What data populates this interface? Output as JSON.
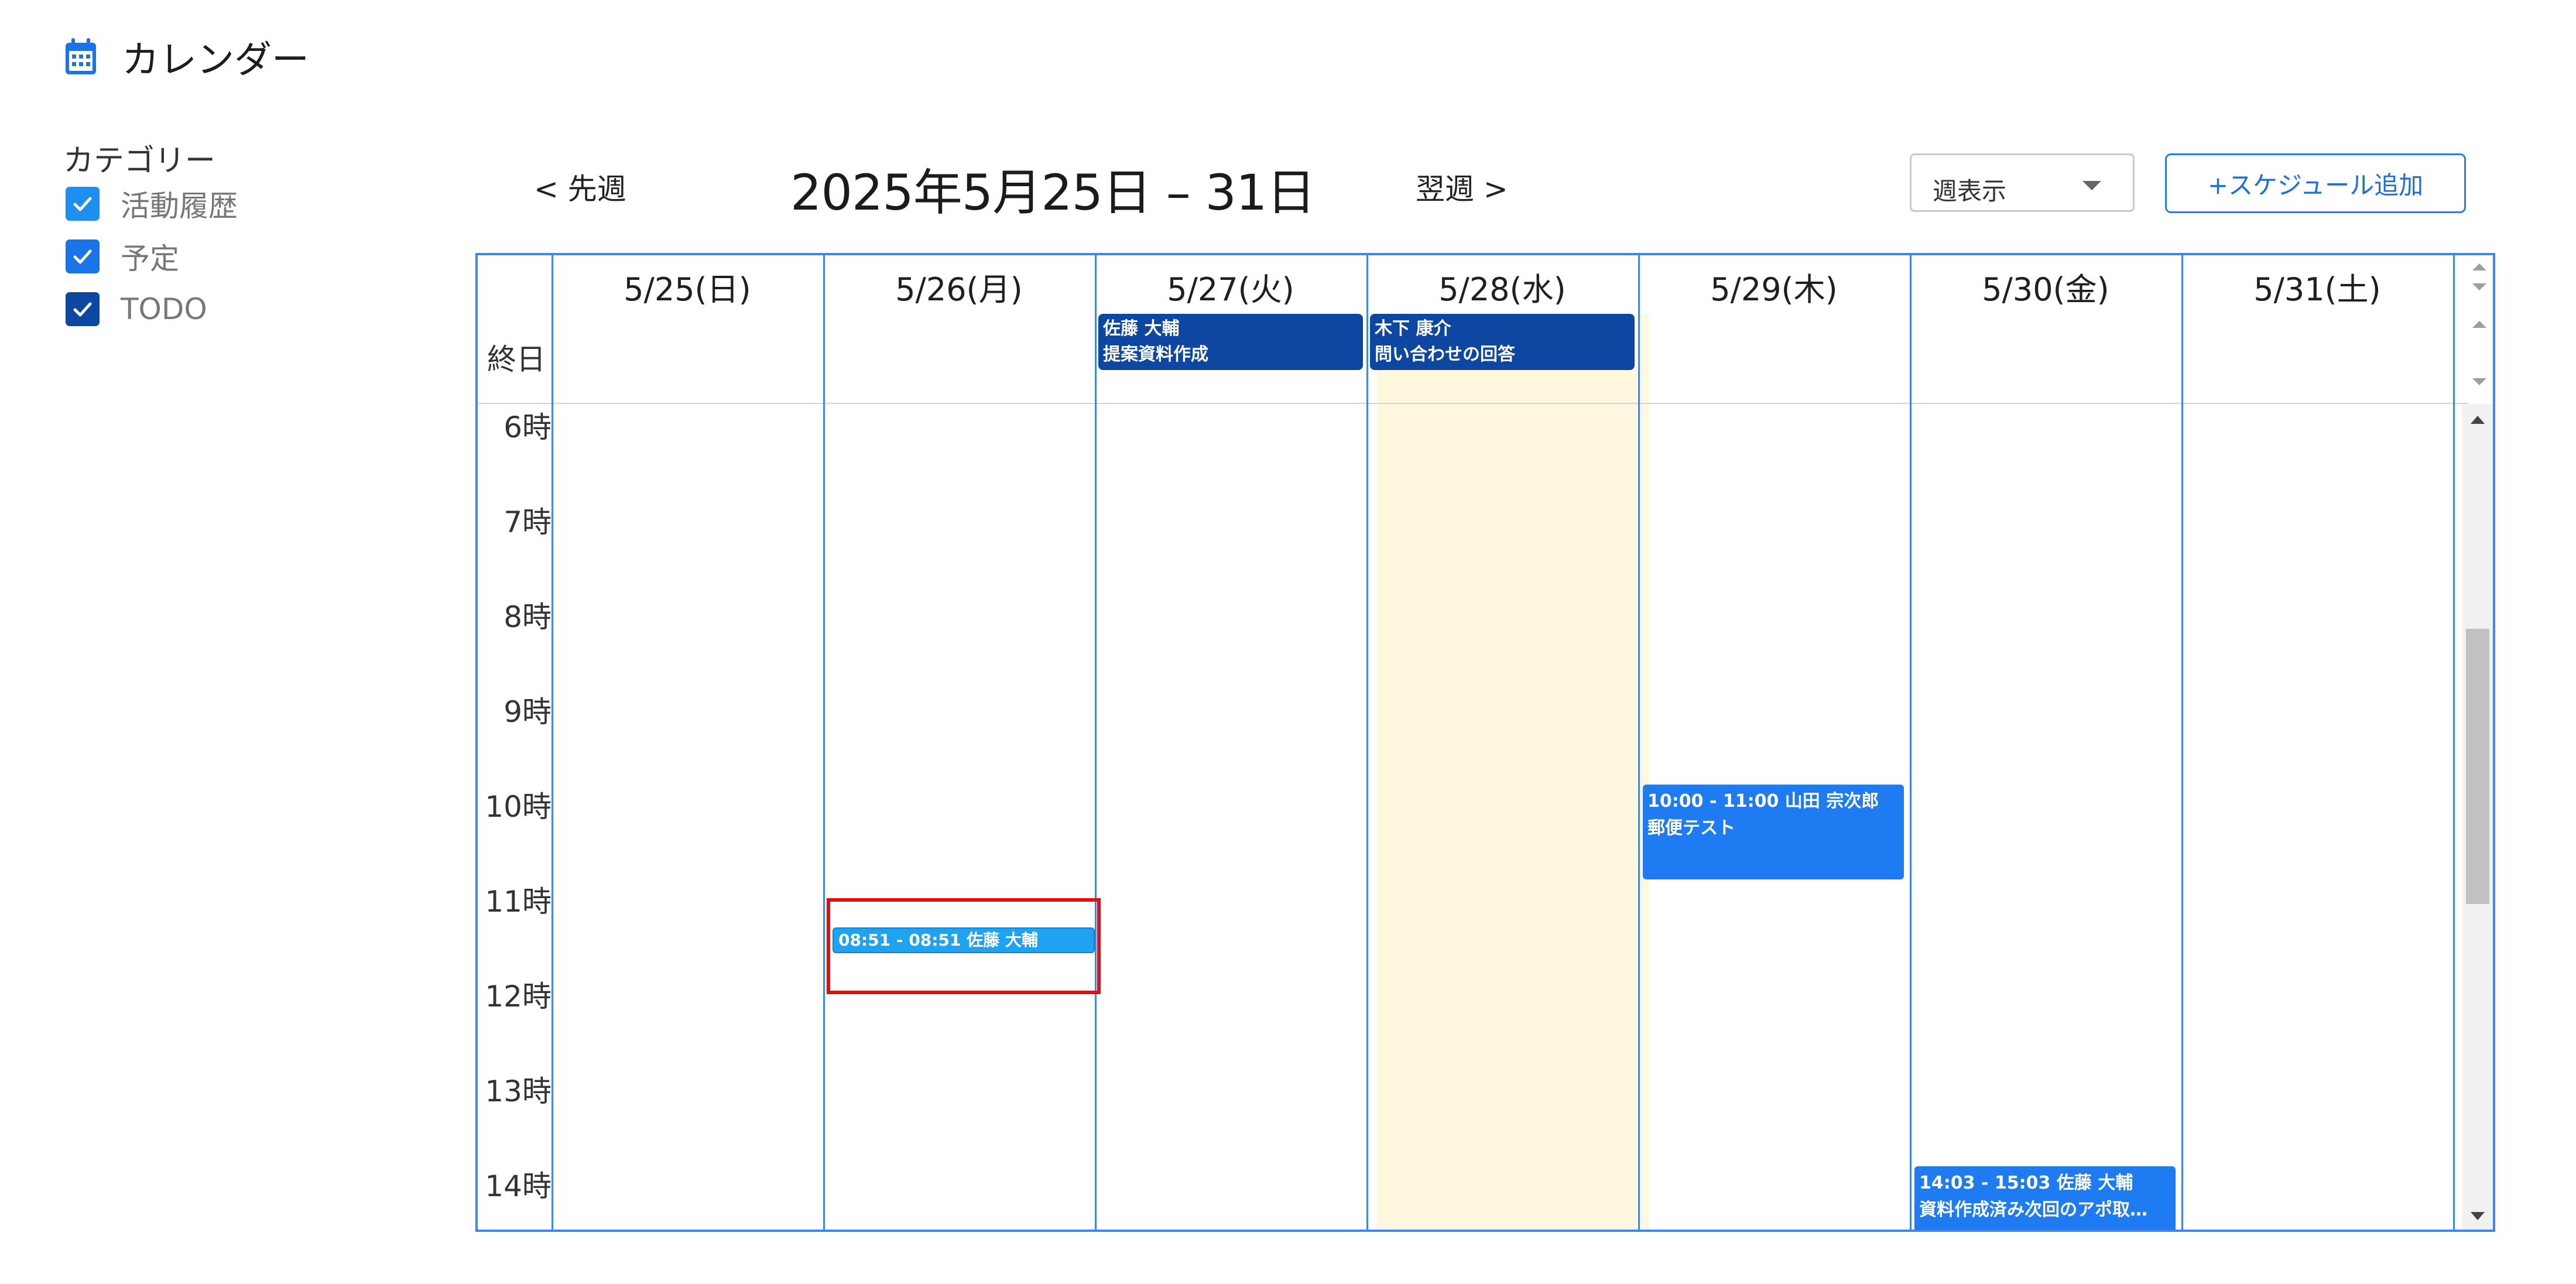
{
  "header": {
    "title": "カレンダー",
    "icon": "calendar-icon"
  },
  "sidebar": {
    "heading": "カテゴリー",
    "categories": [
      {
        "label": "活動履歴",
        "checked": true,
        "color": "#1f8ef1"
      },
      {
        "label": "予定",
        "checked": true,
        "color": "#1a73e8"
      },
      {
        "label": "TODO",
        "checked": true,
        "color": "#0d47a1"
      }
    ]
  },
  "toolbar": {
    "prev_label": "< 先週",
    "range_title": "2025年5月25日 – 31日",
    "next_label": "翌週 >",
    "view_select": "週表示",
    "add_label": "+スケジュール追加"
  },
  "calendar": {
    "allday_label": "終日",
    "days": [
      "5/25(日)",
      "5/26(月)",
      "5/27(火)",
      "5/28(水)",
      "5/29(木)",
      "5/30(金)",
      "5/31(土)"
    ],
    "highlight_day_index": 3,
    "hours": [
      "6時",
      "7時",
      "8時",
      "9時",
      "10時",
      "11時",
      "12時",
      "13時",
      "14時"
    ],
    "allday_events": [
      {
        "day_index": 2,
        "line1": "佐藤 大輔",
        "line2": "提案資料作成"
      },
      {
        "day_index": 3,
        "line1": "木下 康介",
        "line2": "問い合わせの回答"
      }
    ],
    "timed_events": [
      {
        "day_index": 1,
        "time": "08:51 - 08:51",
        "person": "佐藤 大輔",
        "title": ""
      },
      {
        "day_index": 4,
        "time": "10:00 - 11:00",
        "person": "山田 宗次郎",
        "title": "郵便テスト"
      },
      {
        "day_index": 5,
        "time": "14:03 - 15:03",
        "person": "佐藤 大輔",
        "title": "資料作成済み次回のアポ取…"
      }
    ],
    "colors": {
      "border": "#3f86f0",
      "event": "#1e7bf2",
      "allday_event": "#0d47a1",
      "today_bg": "#fff7de",
      "selection": "#e01010"
    }
  }
}
